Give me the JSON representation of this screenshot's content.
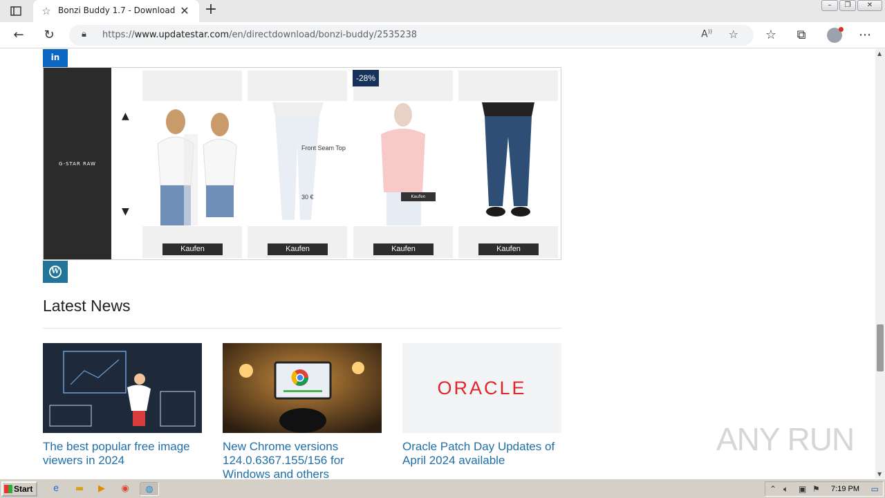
{
  "browser": {
    "tab_title": "Bonzi Buddy 1.7 - Download",
    "url_prefix": "https://",
    "url_domain": "www.updatestar.com",
    "url_path": "/en/directdownload/bonzi-buddy/2535238"
  },
  "social": {
    "linkedin_label": "in",
    "wordpress_label": "W"
  },
  "ad": {
    "brand": "G-STAR RAW",
    "discount": "-28%",
    "product_name": "Front Seam Top",
    "price": "30 €",
    "mini_button": "Kaufen",
    "cards": [
      {
        "button": "Kaufen"
      },
      {
        "button": "Kaufen"
      },
      {
        "button": "Kaufen"
      },
      {
        "button": "Kaufen"
      }
    ]
  },
  "news": {
    "section_title": "Latest News",
    "items": [
      {
        "headline": "The best popular free image viewers in 2024"
      },
      {
        "headline": "New Chrome versions 124.0.6367.155/156 for Windows and others"
      },
      {
        "headline": "Oracle Patch Day Updates of April 2024 available",
        "logo_text": "ORACLE"
      }
    ]
  },
  "watermark": "ANY RUN",
  "taskbar": {
    "start_label": "Start",
    "clock": "7:19 PM"
  },
  "colors": {
    "link_blue": "#1e6fa8",
    "linkedin": "#0a66c2",
    "wordpress": "#21759b",
    "oracle_red": "#e0262b"
  }
}
